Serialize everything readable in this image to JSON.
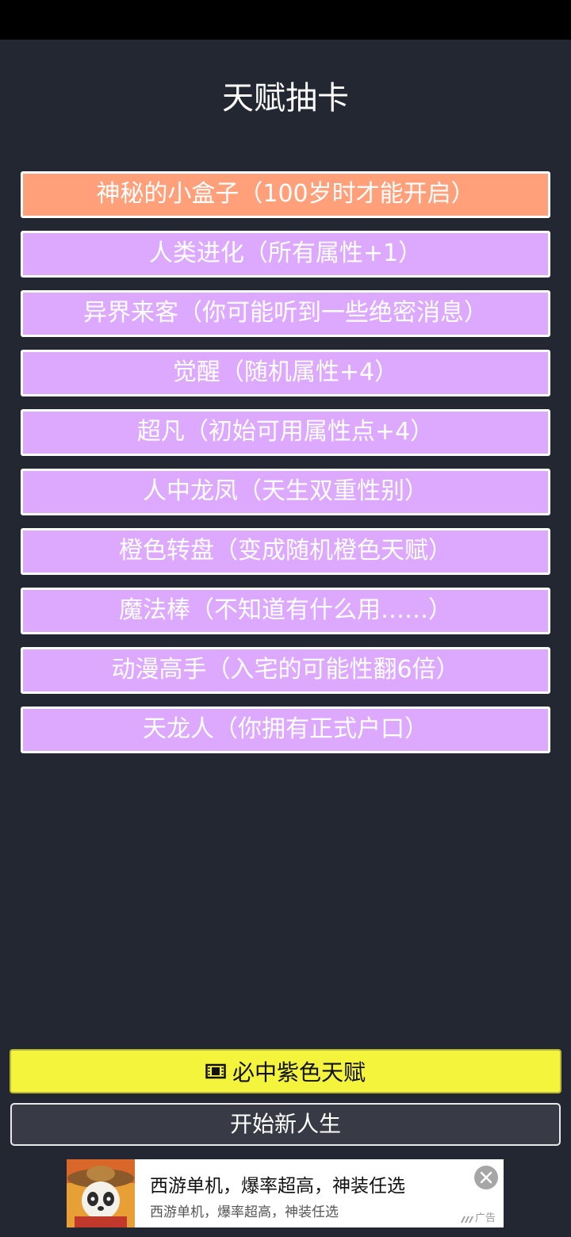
{
  "header": {
    "title": "天赋抽卡"
  },
  "talents": [
    {
      "label": "神秘的小盒子（100岁时才能开启）",
      "color": "#ffa07a"
    },
    {
      "label": "人类进化（所有属性+1）",
      "color": "#dda9ff"
    },
    {
      "label": "异界来客（你可能听到一些绝密消息）",
      "color": "#dda9ff"
    },
    {
      "label": "觉醒（随机属性+4）",
      "color": "#dda9ff"
    },
    {
      "label": "超凡（初始可用属性点+4）",
      "color": "#dda9ff"
    },
    {
      "label": "人中龙凤（天生双重性别）",
      "color": "#dda9ff"
    },
    {
      "label": "橙色转盘（变成随机橙色天赋）",
      "color": "#dda9ff"
    },
    {
      "label": "魔法棒（不知道有什么用……）",
      "color": "#dda9ff"
    },
    {
      "label": "动漫高手（入宅的可能性翻6倍）",
      "color": "#dda9ff"
    },
    {
      "label": "天龙人（你拥有正式户口）",
      "color": "#dda9ff"
    }
  ],
  "actions": {
    "guarantee_purple_label": "必中紫色天赋",
    "guarantee_purple_icon": "video-ad-icon",
    "new_life_label": "开始新人生"
  },
  "ad": {
    "title": "西游单机，爆率超高，神装任选",
    "subtitle": "西游单机，爆率超高，神装任选",
    "label": "广告",
    "close_icon": "close-icon"
  },
  "colors": {
    "background": "#232731",
    "purple_card": "#dda9ff",
    "orange_card": "#ffa07a",
    "yellow_button": "#f4f43c"
  }
}
